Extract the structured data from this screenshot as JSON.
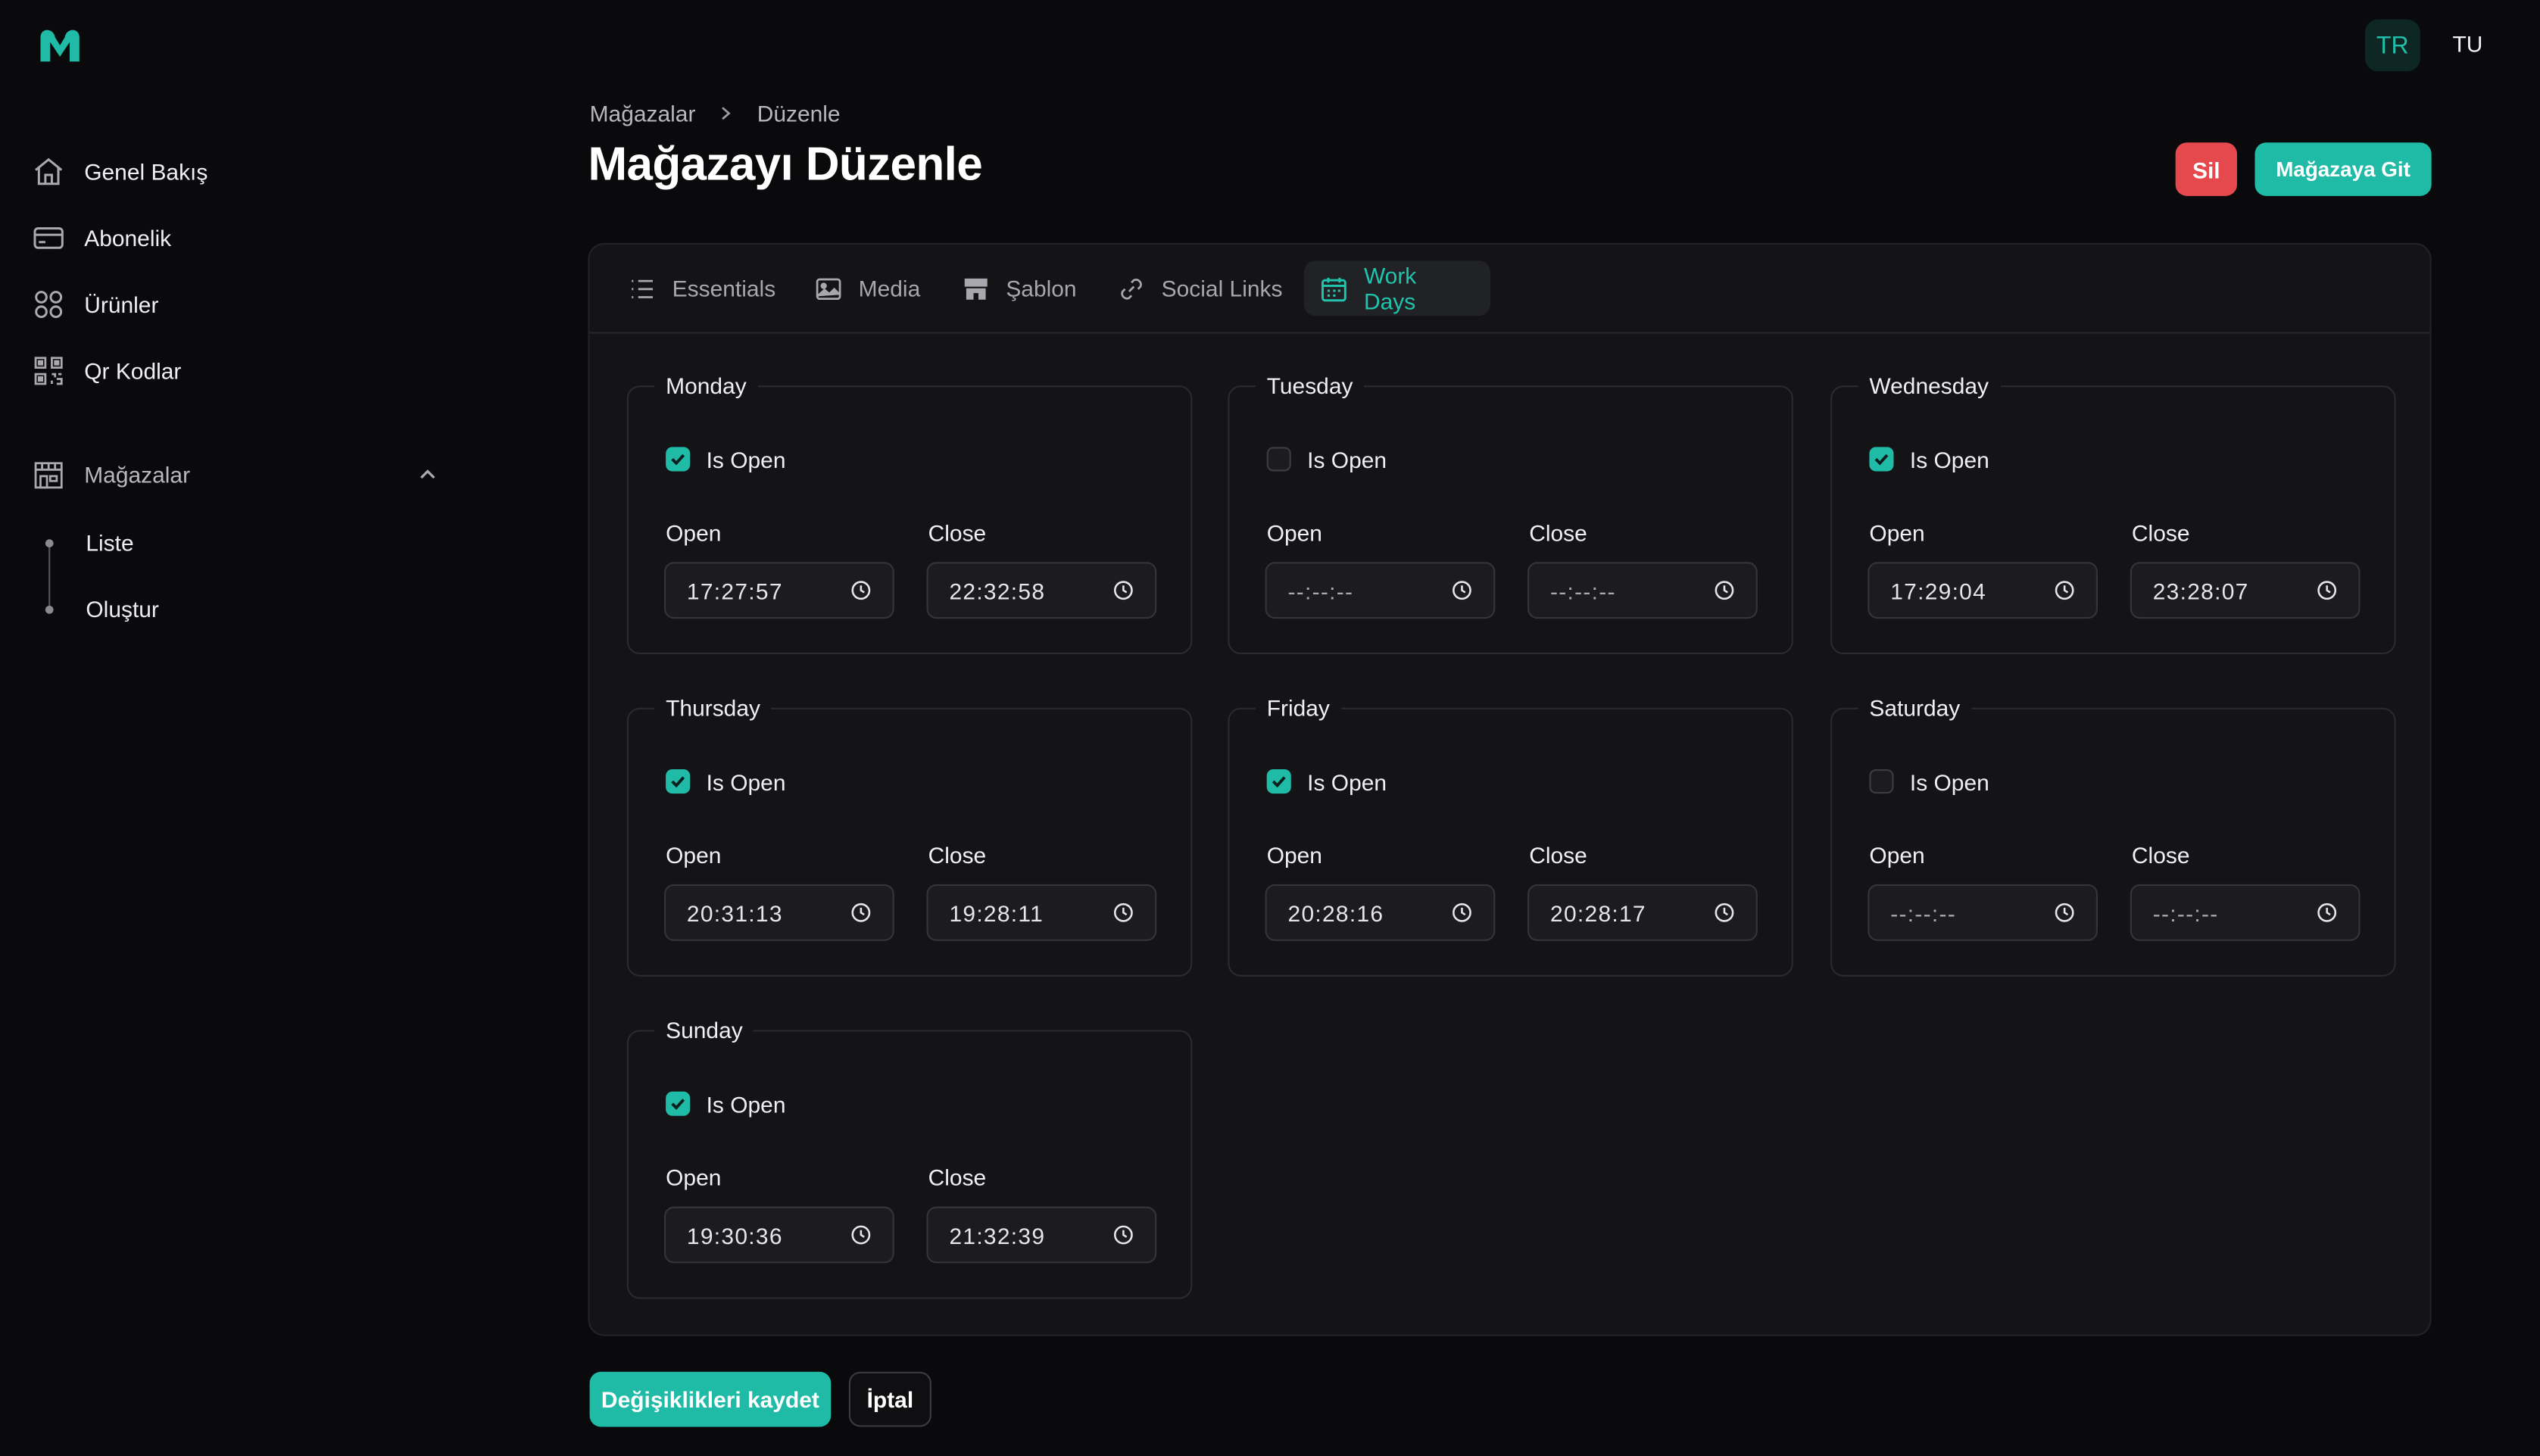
{
  "header": {
    "lang_active": "TR",
    "lang_user": "TU",
    "breadcrumb": [
      "Mağazalar",
      "Düzenle"
    ],
    "title": "Mağazayı Düzenle",
    "delete_label": "Sil",
    "goto_label": "Mağazaya Git"
  },
  "sidebar": {
    "items": [
      {
        "label": "Genel Bakış",
        "icon": "home-icon"
      },
      {
        "label": "Abonelik",
        "icon": "card-icon"
      },
      {
        "label": "Ürünler",
        "icon": "grid-icon"
      },
      {
        "label": "Qr Kodlar",
        "icon": "qr-icon"
      }
    ],
    "section": {
      "label": "Mağazalar",
      "icon": "store-icon",
      "expanded": true
    },
    "sub_items": [
      "Liste",
      "Oluştur"
    ]
  },
  "tabs": [
    {
      "label": "Essentials",
      "icon": "list-icon",
      "active": false
    },
    {
      "label": "Media",
      "icon": "image-icon",
      "active": false
    },
    {
      "label": "Şablon",
      "icon": "store-template-icon",
      "active": false
    },
    {
      "label": "Social Links",
      "icon": "link-icon",
      "active": false
    },
    {
      "label": "Work Days",
      "icon": "calendar-icon",
      "active": true
    }
  ],
  "labels": {
    "is_open": "Is Open",
    "open": "Open",
    "close": "Close"
  },
  "days": [
    {
      "name": "Monday",
      "is_open": true,
      "open": "17:27:57",
      "close": "22:32:58"
    },
    {
      "name": "Tuesday",
      "is_open": false,
      "open": "--:--:--",
      "close": "--:--:--"
    },
    {
      "name": "Wednesday",
      "is_open": true,
      "open": "17:29:04",
      "close": "23:28:07"
    },
    {
      "name": "Thursday",
      "is_open": true,
      "open": "20:31:13",
      "close": "19:28:11"
    },
    {
      "name": "Friday",
      "is_open": true,
      "open": "20:28:16",
      "close": "20:28:17"
    },
    {
      "name": "Saturday",
      "is_open": false,
      "open": "--:--:--",
      "close": "--:--:--"
    },
    {
      "name": "Sunday",
      "is_open": true,
      "open": "19:30:36",
      "close": "21:32:39"
    }
  ],
  "footer": {
    "save_label": "Değişiklikleri kaydet",
    "cancel_label": "İptal"
  },
  "colors": {
    "accent": "#1fbba6",
    "danger": "#e5484d",
    "background": "#0a0a0c",
    "panel": "#141416"
  }
}
